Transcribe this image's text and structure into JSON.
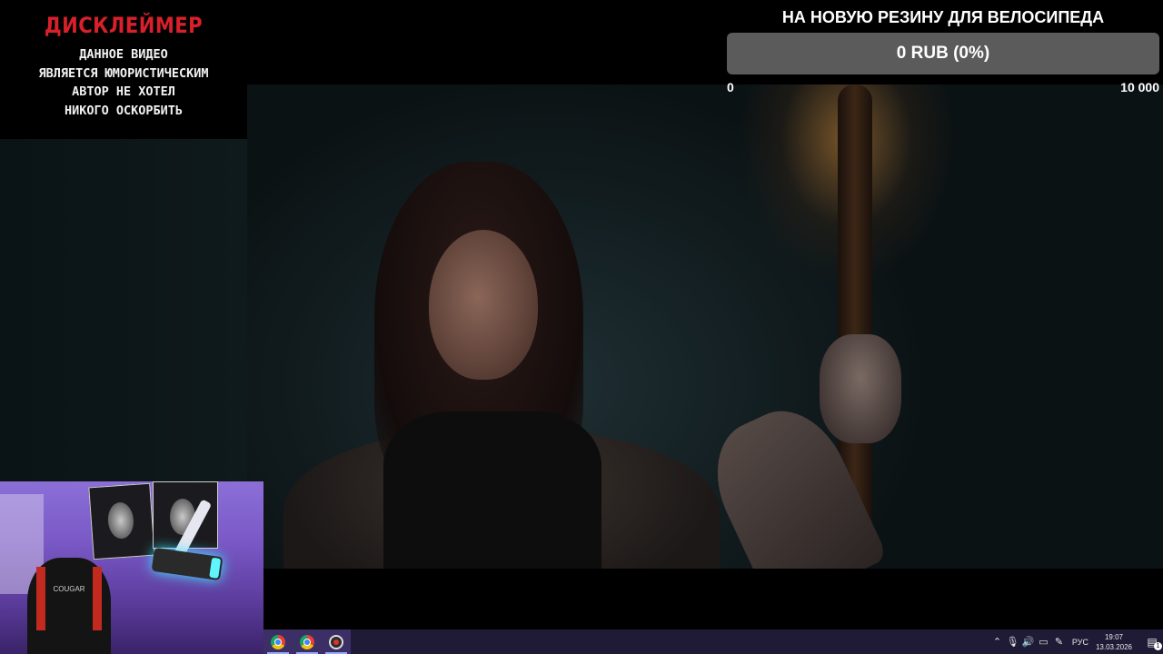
{
  "disclaimer": {
    "title": "ДИСКЛЕЙМЕР",
    "lines": [
      "ДАННОЕ ВИДЕО",
      "ЯВЛЯЕТСЯ ЮМОРИСТИЧЕСКИМ",
      "АВТОР НЕ ХОТЕЛ",
      "НИКОГО ОСКОРБИТЬ"
    ]
  },
  "donation_goal": {
    "title": "НА НОВУЮ РЕЗИНУ ДЛЯ ВЕЛОСИПЕДА",
    "progress_text": "0 RUB (0%)",
    "progress_fraction": 0,
    "min_label": "0",
    "max_label": "10 000",
    "bar_color": "#5b5b5b"
  },
  "webcam": {
    "chair_brand": "COUGAR"
  },
  "taskbar": {
    "apps": [
      {
        "icon": "chrome-icon",
        "active": true
      },
      {
        "icon": "chrome-icon",
        "active": true
      },
      {
        "icon": "obs-icon",
        "active": true
      }
    ],
    "tray": {
      "icons": [
        "chevron-up-icon",
        "microphone-icon",
        "speaker-icon",
        "network-icon",
        "pen-icon"
      ],
      "language": "РУС",
      "time": "19:07",
      "date": "13.03.2026",
      "notification_count": "1"
    }
  }
}
